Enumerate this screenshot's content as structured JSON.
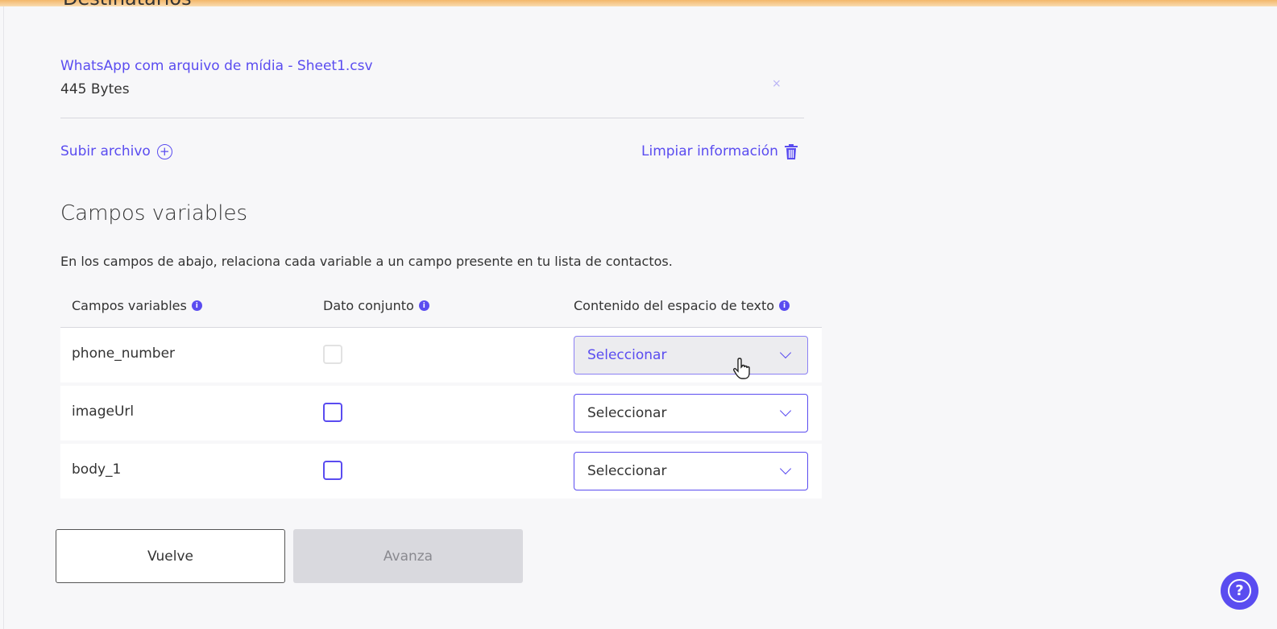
{
  "section_title": "Destinatarios",
  "file": {
    "name": "WhatsApp com arquivo de mídia - Sheet1.csv",
    "size": "445 Bytes",
    "remove_icon": "×"
  },
  "actions": {
    "upload": "Subir archivo",
    "clear": "Limpiar información"
  },
  "variables": {
    "title": "Campos variables",
    "description": "En los campos de abajo, relaciona cada variable a un campo presente en tu lista de contactos.",
    "columns": [
      "Campos variables",
      "Dato conjunto",
      "Contenido del espacio de texto"
    ],
    "rows": [
      {
        "name": "phone_number",
        "checkbox_disabled": true,
        "select": "Seleccionar"
      },
      {
        "name": "imageUrl",
        "checkbox_disabled": false,
        "select": "Seleccionar"
      },
      {
        "name": "body_1",
        "checkbox_disabled": false,
        "select": "Seleccionar"
      }
    ]
  },
  "buttons": {
    "back": "Vuelve",
    "next": "Avanza"
  },
  "help": "?",
  "colors": {
    "accent": "#5a4cf0"
  }
}
